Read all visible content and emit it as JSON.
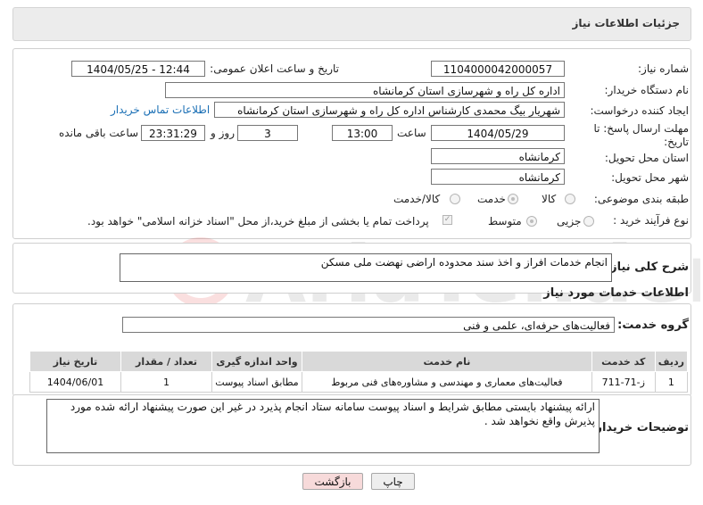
{
  "header": {
    "title": "جزئیات اطلاعات نیاز"
  },
  "form": {
    "need_number_label": "شماره نیاز:",
    "need_number": "1104000042000057",
    "announce_label": "تاریخ و ساعت اعلان عمومی:",
    "announce_value": "1404/05/25 - 12:44",
    "buyer_org_label": "نام دستگاه خریدار:",
    "buyer_org": "اداره کل راه و شهرسازی استان کرمانشاه",
    "creator_label": "ایجاد کننده درخواست:",
    "creator": "شهریار بیگ محمدی کارشناس اداره کل راه و شهرسازی استان کرمانشاه",
    "contact_link": "اطلاعات تماس خریدار",
    "deadline_label": "مهلت ارسال پاسخ: تا تاریخ:",
    "deadline_date": "1404/05/29",
    "time_label": "ساعت",
    "deadline_time": "13:00",
    "days_value": "3",
    "days_label": "روز و",
    "remaining_time": "23:31:29",
    "remaining_label": "ساعت باقی مانده",
    "province_label": "استان محل تحویل:",
    "province": "کرمانشاه",
    "city_label": "شهر محل تحویل:",
    "city": "کرمانشاه",
    "category_label": "طبقه بندی موضوعی:",
    "category_options": [
      "کالا",
      "خدمت",
      "کالا/خدمت"
    ],
    "category_selected": "خدمت",
    "process_label": "نوع فرآیند خرید :",
    "process_options": [
      "جزیی",
      "متوسط"
    ],
    "process_selected": "متوسط",
    "payment_note": "پرداخت تمام یا بخشی از مبلغ خرید،از محل \"اسناد خزانه اسلامی\" خواهد بود."
  },
  "summary": {
    "label": "شرح کلی نیاز:",
    "text": "انجام خدمات افراز و اخذ سند محدوده اراضی نهضت ملی مسکن"
  },
  "services": {
    "section_title": "اطلاعات خدمات مورد نیاز",
    "group_label": "گروه خدمت:",
    "group_value": "فعالیت‌های حرفه‌ای، علمی و فنی",
    "table": {
      "headers": [
        "ردیف",
        "کد خدمت",
        "نام خدمت",
        "واحد اندازه گیری",
        "تعداد / مقدار",
        "تاریخ نیاز"
      ],
      "rows": [
        [
          "1",
          "ز-71-711",
          "فعالیت‌های معماری و مهندسی و مشاوره‌های فنی مربوط",
          "مطابق اسناد پیوست",
          "1",
          "1404/06/01"
        ]
      ]
    }
  },
  "buyer_notes": {
    "label": "توضیحات خریدار:",
    "text": "ارائه پیشنهاد بایستی مطابق شرایط و اسناد پیوست سامانه ستاد انجام پذیرد در غیر این صورت پیشنهاد ارائه شده مورد پذیرش واقع نخواهد شد ."
  },
  "buttons": {
    "print": "چاپ",
    "back": "بازگشت"
  },
  "watermark": {
    "text": "AriaTender.neT"
  },
  "colors": {
    "link": "#1a6fb5",
    "table_header": "#d9d9d9",
    "back_button": "#f7dada",
    "print_button": "#eeeeee"
  }
}
